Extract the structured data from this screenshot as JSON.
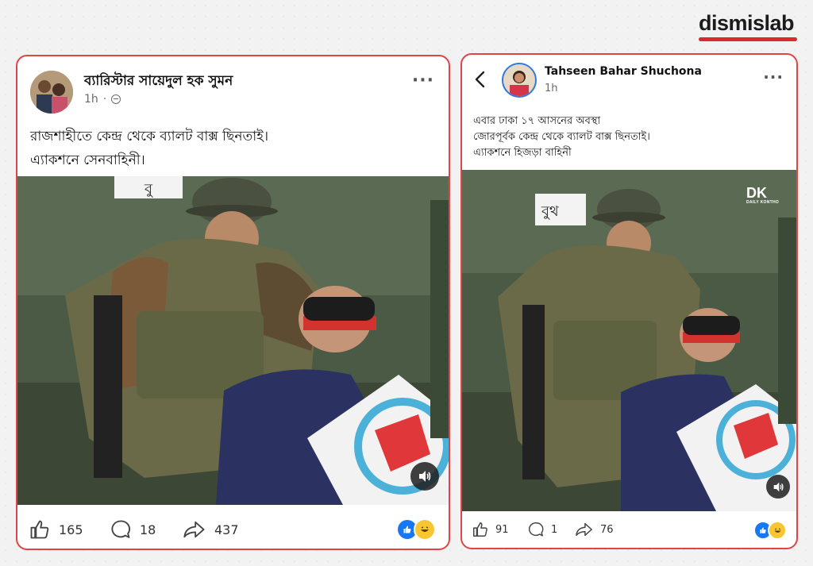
{
  "brand": {
    "name": "dismislab",
    "accent": "#d92b2b"
  },
  "left_post": {
    "author": "ব্যারিস্টার সায়েদুল হক সুমন",
    "time": "1h",
    "text_lines": [
      "রাজশাহীতে কেন্দ্র থেকে ব্যালট বাক্স ছিনতাই।",
      "এ্যাকশনে সেনবাহিনী।"
    ],
    "video_sign": "বু",
    "stats": {
      "likes": "165",
      "comments": "18",
      "shares": "437"
    },
    "icons": [
      "like-icon",
      "comment-icon",
      "share-icon",
      "globe-icon",
      "more-icon",
      "sound-icon",
      "like-reaction-icon",
      "haha-reaction-icon"
    ]
  },
  "right_post": {
    "author": "Tahseen Bahar Shuchona",
    "time": "1h",
    "text_lines": [
      "এবার ঢাকা ১৭ আসনের অবস্থা",
      "জোরপূর্বক কেন্দ্র থেকে ব্যালট বাক্স ছিনতাই।",
      "এ্যাকশনে হিজড়া বাহিনী"
    ],
    "video_sign": "বুথ",
    "watermark": "DK",
    "watermark_sub": "DAILY KONTHO",
    "stats": {
      "likes": "91",
      "comments": "1",
      "shares": "76"
    },
    "icons": [
      "back-arrow-icon",
      "like-icon",
      "comment-icon",
      "share-icon",
      "more-icon",
      "sound-icon",
      "like-reaction-icon",
      "haha-reaction-icon"
    ]
  },
  "colors": {
    "card_border": "#e04545",
    "fb_blue": "#1877f2",
    "haha_yellow": "#f7c630"
  }
}
